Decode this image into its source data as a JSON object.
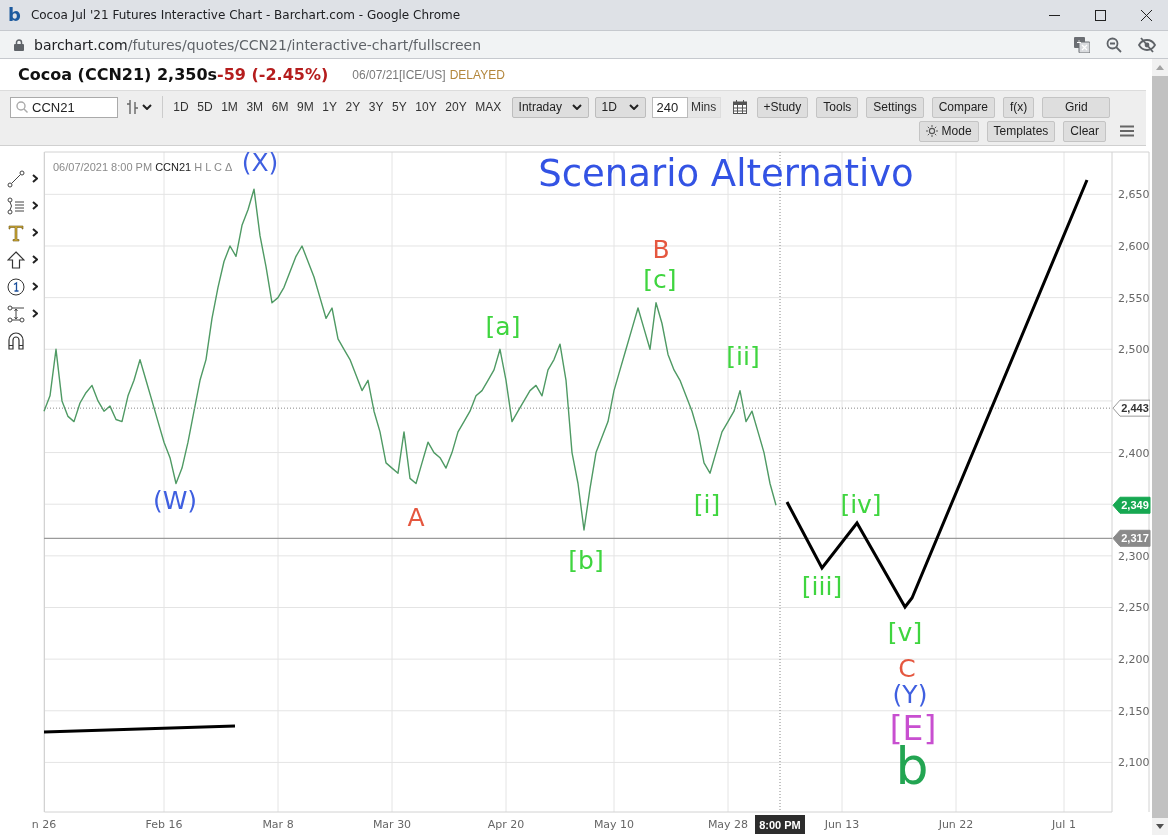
{
  "browser": {
    "favicon": "b",
    "title": "Cocoa Jul '21 Futures Interactive Chart - Barchart.com - Google Chrome",
    "url_host": "barchart.com",
    "url_path": "/futures/quotes/CCN21/interactive-chart/fullscreen"
  },
  "quote": {
    "name": "Cocoa (CCN21) 2,350s",
    "change": "-59 (-2.45%)",
    "date_exchange": "06/07/21[ICE/US]",
    "status": "DELAYED"
  },
  "toolbar": {
    "symbol": "CCN21",
    "periods": [
      "1D",
      "5D",
      "1M",
      "3M",
      "6M",
      "9M",
      "1Y",
      "2Y",
      "3Y",
      "5Y",
      "10Y",
      "20Y",
      "MAX"
    ],
    "interval": "Intraday",
    "range": "1D",
    "minutes": "240",
    "minutes_unit": "Mins",
    "buttons": [
      "+Study",
      "Tools",
      "Settings",
      "Compare",
      "f(x)",
      "Grid"
    ],
    "second_row": [
      {
        "label": "Mode",
        "kind": "mode"
      },
      {
        "label": "Templates",
        "kind": "plain"
      },
      {
        "label": "Clear",
        "kind": "plain"
      }
    ]
  },
  "chart": {
    "legend": {
      "datetime": "06/07/2021 8:00 PM",
      "fields": "H L C Δ"
    },
    "overlay_title": "Scenario Alternativo",
    "wave_labels": [
      {
        "text": "(X)",
        "kind": "label",
        "color": "#3f5fe0"
      },
      {
        "text": "B",
        "kind": "label",
        "color": "#e5573f"
      },
      {
        "text": "[c]",
        "kind": "label",
        "color": "#3fd53f"
      },
      {
        "text": "[a]",
        "kind": "label",
        "color": "#3fd53f"
      },
      {
        "text": "[ii]",
        "kind": "label",
        "color": "#3fd53f"
      },
      {
        "text": "(W)",
        "kind": "label",
        "color": "#3f5fe0"
      },
      {
        "text": "[i]",
        "kind": "label",
        "color": "#3fd53f"
      },
      {
        "text": "[iv]",
        "kind": "label",
        "color": "#3fd53f"
      },
      {
        "text": "A",
        "kind": "label",
        "color": "#e5573f"
      },
      {
        "text": "[b]",
        "kind": "label",
        "color": "#3fd53f"
      },
      {
        "text": "[iii]",
        "kind": "label",
        "color": "#3fd53f"
      },
      {
        "text": "[v]",
        "kind": "label",
        "color": "#3fd53f"
      },
      {
        "text": "C",
        "kind": "label",
        "color": "#e5573f"
      },
      {
        "text": "(Y)",
        "kind": "label",
        "color": "#3f5fe0"
      },
      {
        "text": "[E]",
        "kind": "large",
        "color": "#c84fd0"
      },
      {
        "text": "b",
        "kind": "huge",
        "color": "#23a552"
      }
    ],
    "crosshair": {
      "time": "8:00 PM",
      "price": "2,443"
    },
    "chart_data": {
      "type": "line",
      "grid": true,
      "ylim": [
        2052,
        2691
      ],
      "yticks": [
        {
          "value": 2650,
          "label": "2,650"
        },
        {
          "value": 2600,
          "label": "2,600"
        },
        {
          "value": 2550,
          "label": "2,550"
        },
        {
          "value": 2500,
          "label": "2,500"
        },
        {
          "value": 2400,
          "label": "2,400"
        },
        {
          "value": 2300,
          "label": "2,300"
        },
        {
          "value": 2250,
          "label": "2,250"
        },
        {
          "value": 2200,
          "label": "2,200"
        },
        {
          "value": 2150,
          "label": "2,150"
        },
        {
          "value": 2100,
          "label": "2,100"
        }
      ],
      "categories": [
        "n 26",
        null,
        null,
        null,
        null,
        null,
        null,
        null,
        null,
        null,
        null,
        null,
        null,
        null,
        null,
        null,
        null,
        null,
        null,
        null,
        "Feb 16",
        null,
        null,
        null,
        null,
        null,
        null,
        null,
        null,
        null,
        null,
        null,
        null,
        null,
        null,
        null,
        null,
        null,
        null,
        "Mar 8",
        null,
        null,
        null,
        null,
        null,
        null,
        null,
        null,
        null,
        null,
        null,
        null,
        null,
        null,
        null,
        null,
        null,
        null,
        "Mar 30",
        null,
        null,
        null,
        null,
        null,
        null,
        null,
        null,
        null,
        null,
        null,
        null,
        null,
        null,
        null,
        null,
        null,
        null,
        "Apr 20",
        null,
        null,
        null,
        null,
        null,
        null,
        null,
        null,
        null,
        null,
        null,
        null,
        null,
        null,
        null,
        null,
        null,
        "May 10",
        null,
        null,
        null,
        null,
        null,
        null,
        null,
        null,
        null,
        null,
        null,
        null,
        null,
        null,
        null,
        null,
        null,
        null,
        "May 28",
        null,
        null,
        null,
        null,
        null,
        null,
        null,
        null,
        null,
        null,
        null,
        null,
        null,
        null,
        null,
        null,
        null,
        null,
        "Jun 13",
        null,
        null,
        null,
        null,
        null,
        null,
        null,
        null,
        null,
        null,
        null,
        null,
        null,
        null,
        null,
        null,
        null,
        null,
        "Jun 22",
        null,
        null,
        null,
        null,
        null,
        null,
        null,
        null,
        null,
        null,
        null,
        null,
        null,
        null,
        null,
        null,
        null,
        "Jul 1",
        null,
        null,
        null,
        null,
        null,
        null,
        null,
        null
      ],
      "series": [
        {
          "name": "CCN21",
          "values": [
            2440,
            2455,
            2500,
            2450,
            2435,
            2430,
            2448,
            2458,
            2465,
            2450,
            2440,
            2445,
            2432,
            2430,
            2455,
            2470,
            2490,
            2470,
            2450,
            2430,
            2410,
            2395,
            2370,
            2385,
            2410,
            2440,
            2470,
            2490,
            2530,
            2560,
            2585,
            2600,
            2590,
            2620,
            2635,
            2655,
            2610,
            2580,
            2545,
            2550,
            2560,
            2575,
            2590,
            2600,
            2585,
            2570,
            2550,
            2530,
            2540,
            2510,
            2500,
            2490,
            2475,
            2460,
            2470,
            2440,
            2420,
            2390,
            2385,
            2380,
            2420,
            2375,
            2370,
            2390,
            2410,
            2400,
            2395,
            2385,
            2400,
            2420,
            2430,
            2440,
            2455,
            2460,
            2470,
            2480,
            2500,
            2470,
            2430,
            2440,
            2450,
            2460,
            2465,
            2455,
            2480,
            2490,
            2505,
            2470,
            2400,
            2370,
            2325,
            2365,
            2400,
            2415,
            2430,
            2460,
            2480,
            2500,
            2520,
            2540,
            2520,
            2500,
            2545,
            2525,
            2495,
            2480,
            2470,
            2455,
            2440,
            2420,
            2390,
            2380,
            2400,
            2420,
            2430,
            2440,
            2460,
            2430,
            2440,
            2420,
            2400,
            2370,
            2349,
            null,
            null,
            null,
            null,
            null,
            null,
            null,
            null,
            null,
            null,
            null,
            null,
            null,
            null,
            null,
            null,
            null,
            null,
            null,
            null,
            null,
            null,
            null,
            null,
            null,
            null,
            null,
            null,
            null,
            null,
            null,
            null,
            null,
            null,
            null,
            null,
            null,
            null,
            null,
            null,
            null,
            null,
            null,
            null,
            null,
            null,
            null,
            null,
            null,
            null,
            null,
            null,
            null,
            null,
            null,
            null
          ]
        }
      ],
      "ref_lines": [
        {
          "axis": "y",
          "value": 2317,
          "label": "2,317"
        }
      ],
      "annotations": [
        "2,349"
      ]
    }
  }
}
